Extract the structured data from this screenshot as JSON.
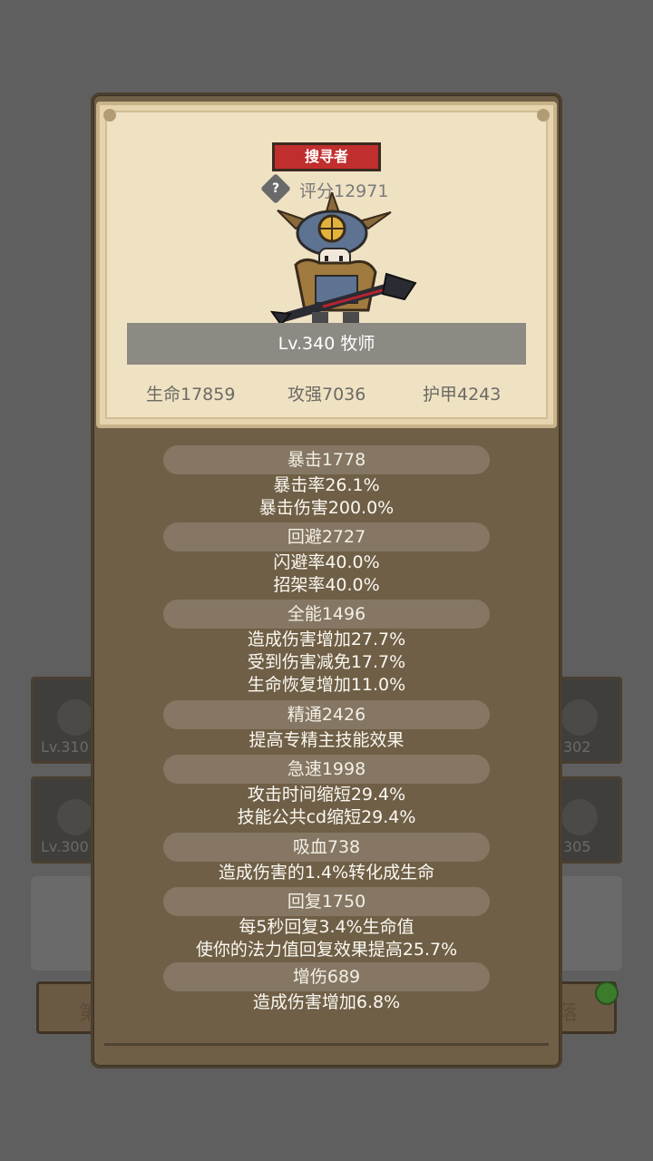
{
  "background": {
    "slot_levels": [
      "Lv.310",
      "302",
      "Lv.300",
      "305"
    ],
    "left_button_glyph": "第",
    "right_button_glyph": "落"
  },
  "hero_card": {
    "rank": "搜寻者",
    "help_icon": "?",
    "score": "评分12971",
    "level_class": "Lv.340 牧师",
    "stats": {
      "hp": "生命17859",
      "attack": "攻强7036",
      "armor": "护甲4243"
    }
  },
  "attributes": [
    {
      "header": "暴击1778",
      "lines": [
        "暴击率26.1%",
        "暴击伤害200.0%"
      ]
    },
    {
      "header": "回避2727",
      "lines": [
        "闪避率40.0%",
        "招架率40.0%"
      ]
    },
    {
      "header": "全能1496",
      "lines": [
        "造成伤害增加27.7%",
        "受到伤害减免17.7%",
        "生命恢复增加11.0%"
      ]
    },
    {
      "header": "精通2426",
      "lines": [
        "提高专精主技能效果"
      ]
    },
    {
      "header": "急速1998",
      "lines": [
        "攻击时间缩短29.4%",
        "技能公共cd缩短29.4%"
      ]
    },
    {
      "header": "吸血738",
      "lines": [
        "造成伤害的1.4%转化成生命"
      ]
    },
    {
      "header": "回复1750",
      "lines": [
        "每5秒回复3.4%生命值",
        "使你的法力值回复效果提高25.7%"
      ]
    },
    {
      "header": "增伤689",
      "lines": [
        "造成伤害增加6.8%"
      ]
    }
  ]
}
